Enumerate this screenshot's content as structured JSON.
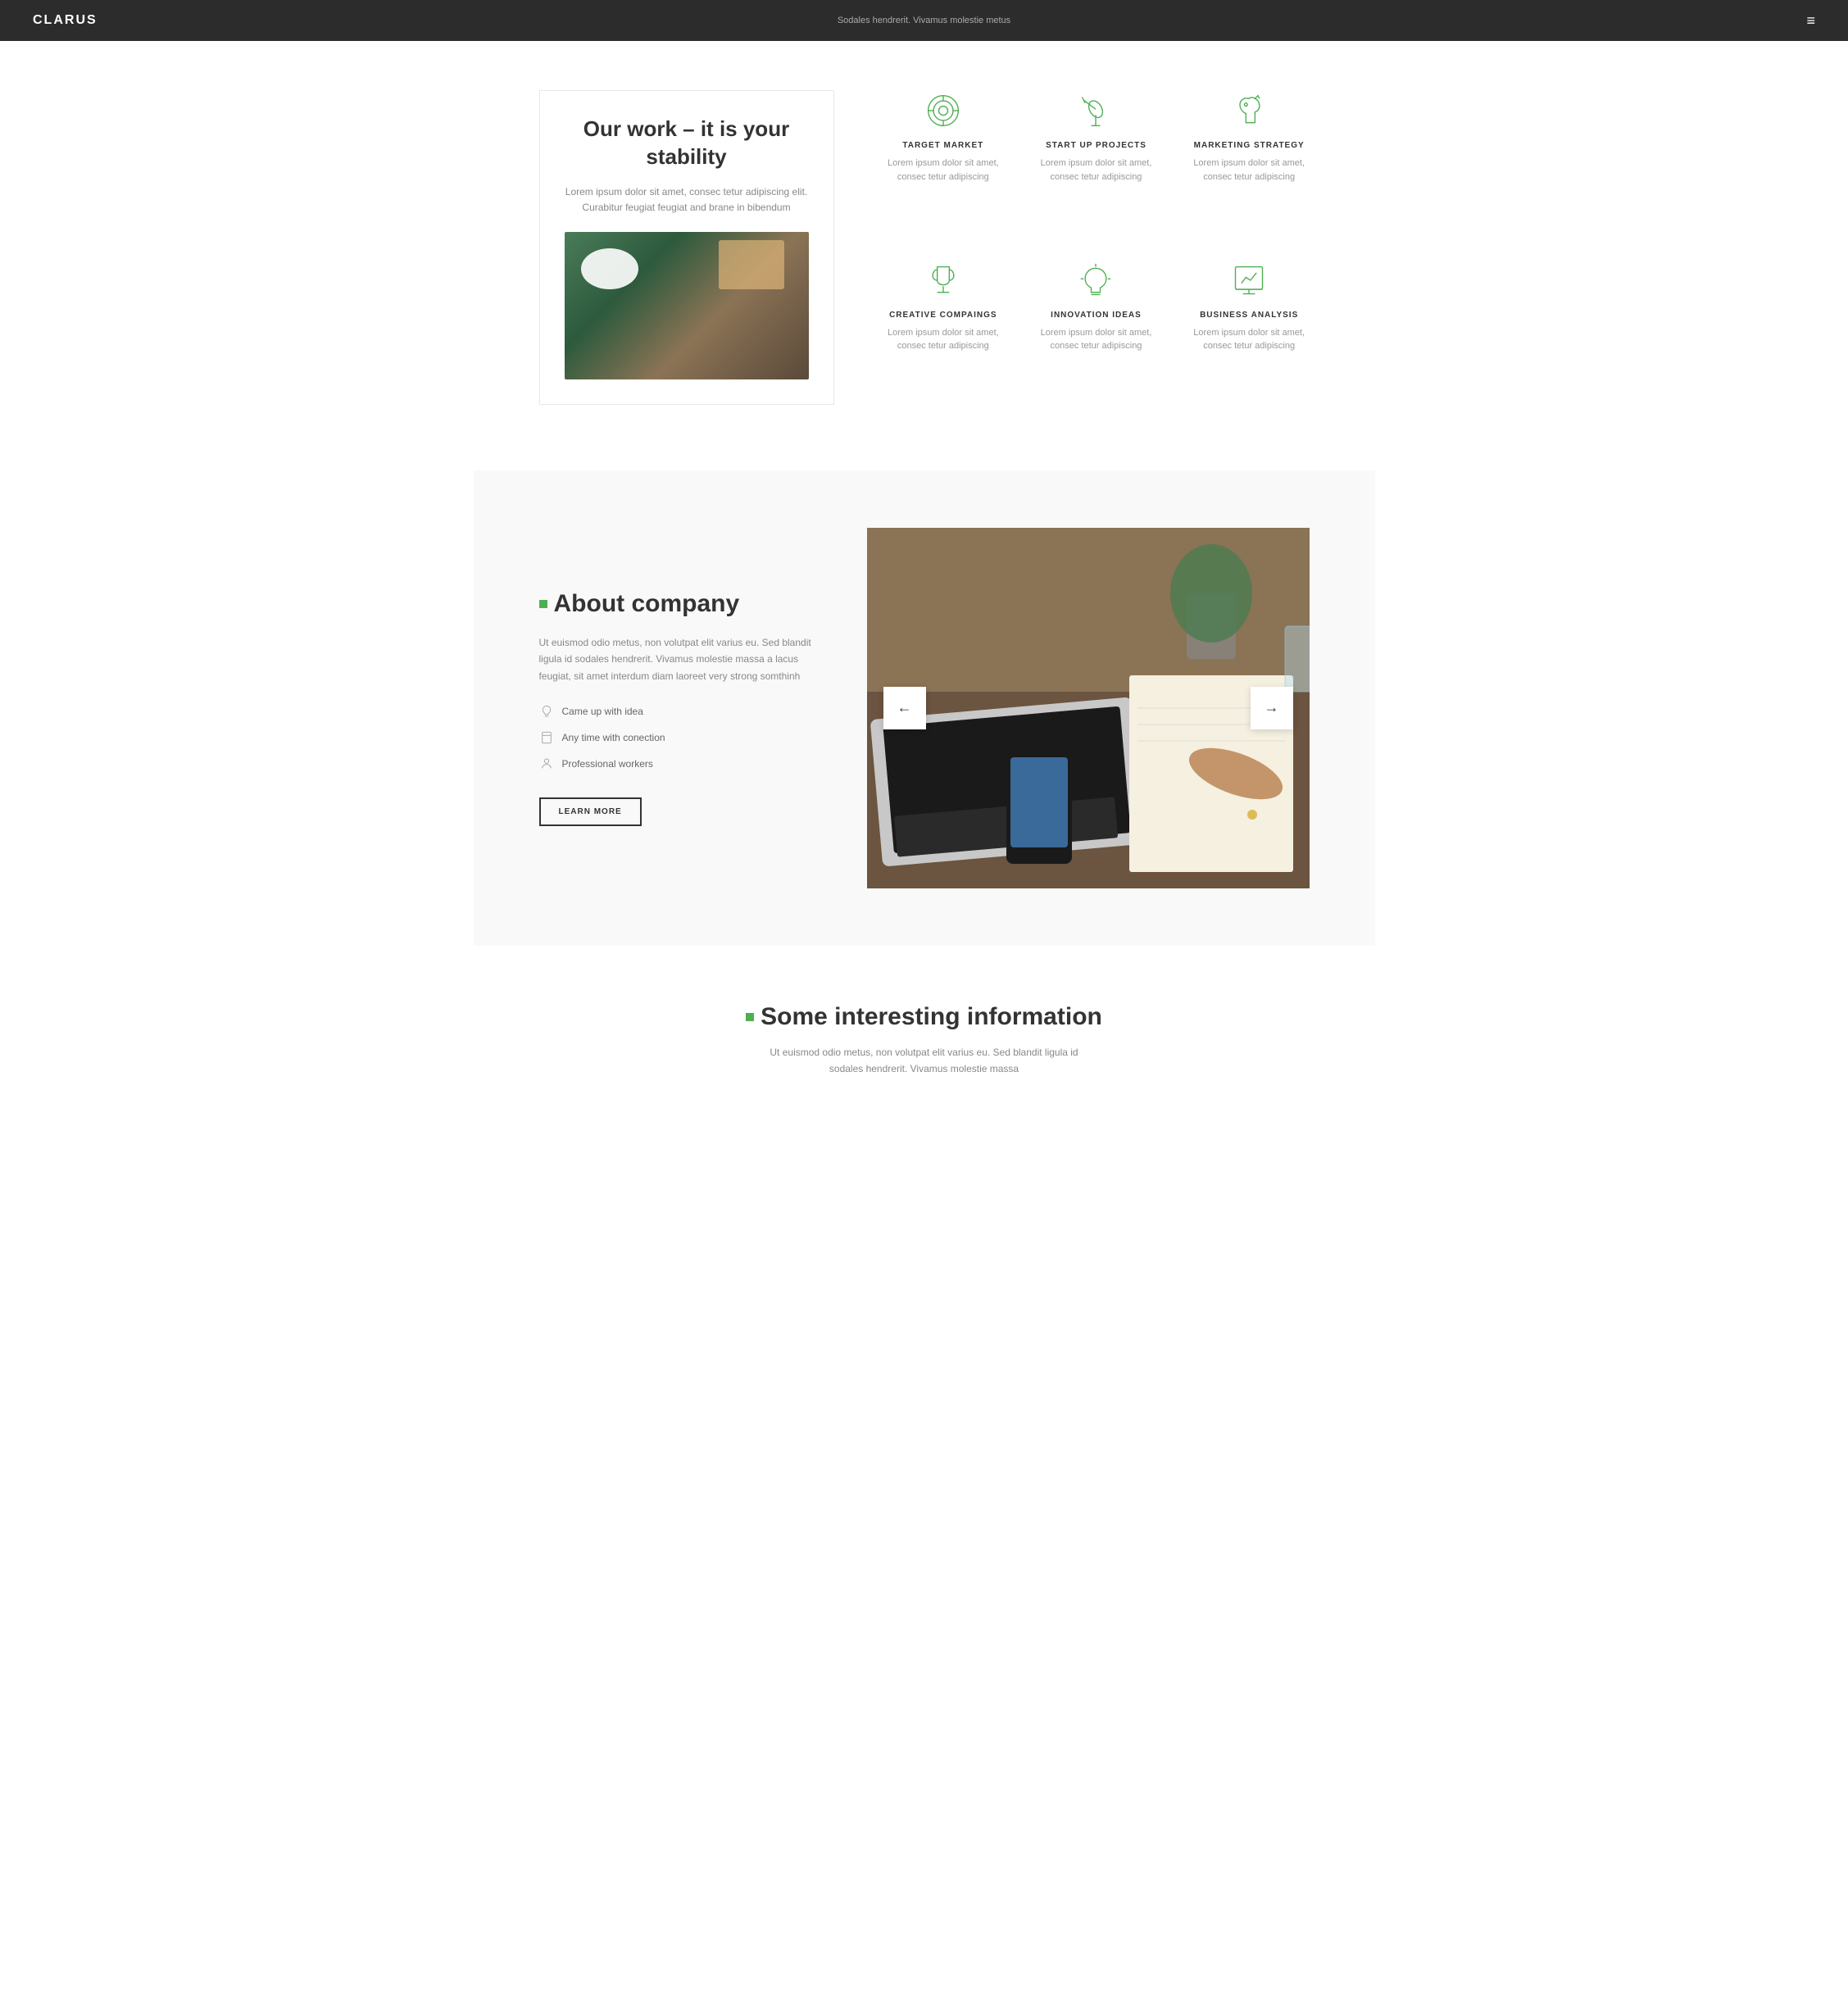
{
  "nav": {
    "logo": "CLARUS",
    "tagline": "Sodales hendrerit. Vivamus molestie metus",
    "menu_icon": "≡"
  },
  "section_work": {
    "title": "Our work – it is your stability",
    "description": "Lorem ipsum dolor sit amet, consec tetur adipiscing elit. Curabitur feugiat feugiat and brane in bibendum",
    "features": [
      {
        "id": "target-market",
        "title": "TARGET MARKET",
        "description": "Lorem ipsum dolor sit amet, consec tetur adipiscing",
        "icon": "target"
      },
      {
        "id": "startup-projects",
        "title": "START UP PROJECTS",
        "description": "Lorem ipsum dolor sit amet, consec tetur adipiscing",
        "icon": "telescope"
      },
      {
        "id": "marketing-strategy",
        "title": "MARKETING STRATEGY",
        "description": "Lorem ipsum dolor sit amet, consec tetur adipiscing",
        "icon": "horse"
      },
      {
        "id": "creative-campaigns",
        "title": "CREATIVE COMPAINGS",
        "description": "Lorem ipsum dolor sit amet, consec tetur adipiscing",
        "icon": "trophy"
      },
      {
        "id": "innovation-ideas",
        "title": "INNOVATION IDEAS",
        "description": "Lorem ipsum dolor sit amet, consec tetur adipiscing",
        "icon": "bulb"
      },
      {
        "id": "business-analysis",
        "title": "BUSINESS ANALYSIS",
        "description": "Lorem ipsum dolor sit amet, consec tetur adipiscing",
        "icon": "chart"
      }
    ]
  },
  "section_about": {
    "heading": "About company",
    "text": "Ut euismod odio metus, non volutpat elit varius eu. Sed blandit ligula id sodales hendrerit. Vivamus molestie massa a lacus feugiat, sit amet interdum diam laoreet very strong somthinh",
    "list_items": [
      {
        "text": "Came up with idea",
        "icon": "lightbulb"
      },
      {
        "text": "Any time with conection",
        "icon": "bookmark"
      },
      {
        "text": "Professional workers",
        "icon": "person"
      }
    ],
    "button_label": "LEARN MORE",
    "carousel_left": "←",
    "carousel_right": "→"
  },
  "section_info": {
    "heading": "Some interesting information",
    "text": "Ut euismod odio metus, non volutpat elit varius eu. Sed blandit ligula id sodales hendrerit. Vivamus molestie massa"
  }
}
